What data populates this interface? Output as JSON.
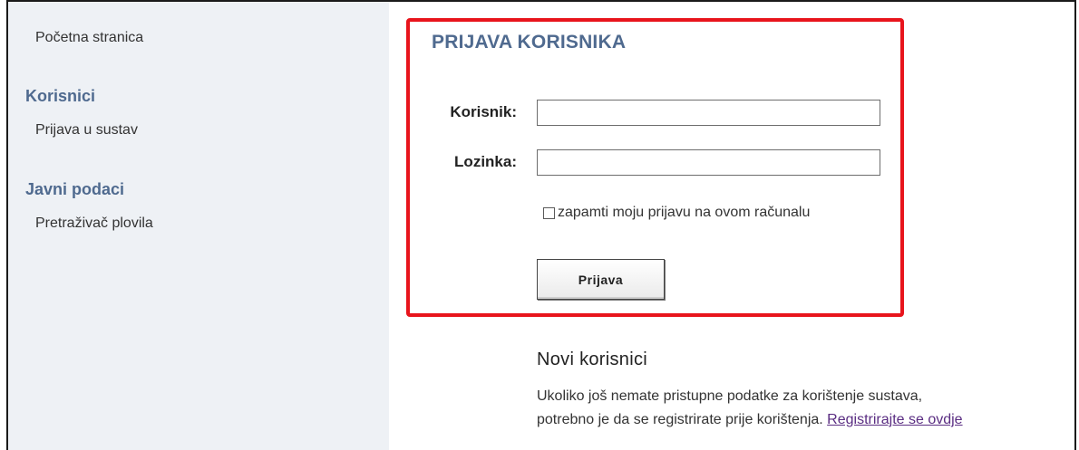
{
  "sidebar": {
    "home_link": "Početna stranica",
    "section_users": "Korisnici",
    "login_link": "Prijava u sustav",
    "section_public": "Javni podaci",
    "vessel_search_link": "Pretraživač plovila"
  },
  "login": {
    "title": "PRIJAVA KORISNIKA",
    "username_label": "Korisnik:",
    "username_value": "",
    "password_label": "Lozinka:",
    "password_value": "",
    "remember_label": "zapamti moju prijavu na ovom računalu",
    "remember_checked": false,
    "submit_label": "Prijava",
    "highlight_color": "#e8141c"
  },
  "new_users": {
    "title": "Novi korisnici",
    "text_line1": "Ukoliko još nemate pristupne podatke za korištenje sustava,",
    "text_line2": "potrebno je da se registrirate prije korištenja.",
    "register_link": "Registrirajte se ovdje"
  },
  "colors": {
    "heading": "#4f6a8f",
    "sidebar_bg": "#eef1f5",
    "link_visited": "#5a2d82"
  }
}
